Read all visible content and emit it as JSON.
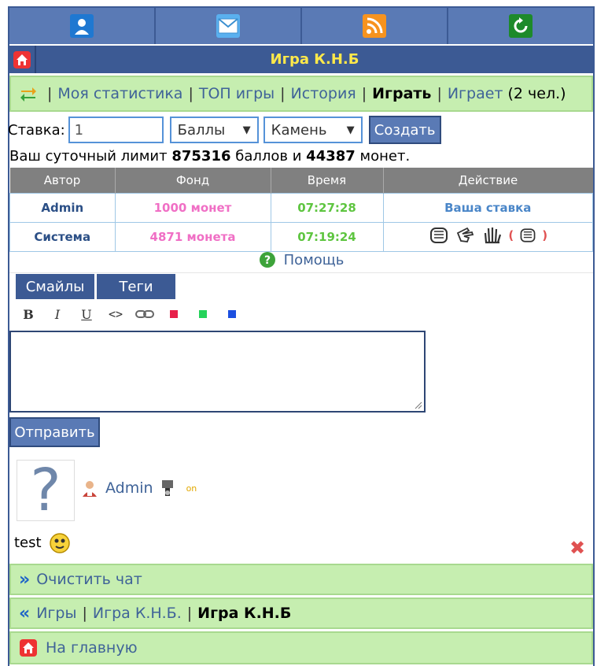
{
  "topbar": {
    "icons": [
      "user-icon",
      "mail-icon",
      "rss-icon",
      "refresh-icon"
    ]
  },
  "title": "Игра К.Н.Б",
  "nav": {
    "stats": "Моя статистика",
    "top": "ТОП игры",
    "history": "История",
    "play": "Играть",
    "playing": "Играет",
    "playing_count": "(2 чел.)"
  },
  "bet": {
    "label": "Ставка:",
    "value": "1",
    "currency": "Баллы",
    "choice": "Камень",
    "create": "Создать"
  },
  "limit": {
    "prefix": "Ваш суточный лимит",
    "points": "875316",
    "mid": "баллов и",
    "coins": "44387",
    "suffix": "монет."
  },
  "table": {
    "headers": [
      "Автор",
      "Фонд",
      "Время",
      "Действие"
    ],
    "rows": [
      {
        "author": "Admin",
        "fund": "1000 монет",
        "time": "07:27:28",
        "action": "Ваша ставка"
      },
      {
        "author": "Система",
        "fund": "4871 монета",
        "time": "07:19:24",
        "action": ""
      }
    ]
  },
  "help": "Помощь",
  "editor": {
    "tab_smiles": "Смайлы",
    "tab_tags": "Теги",
    "bold": "B",
    "italic": "I",
    "underline": "U",
    "code": "<>",
    "send": "Отправить"
  },
  "message": {
    "avatar": "?",
    "author": "Admin",
    "status": "on",
    "text": "test"
  },
  "footer": {
    "clear": "Очистить чат",
    "games": "Игры",
    "game_knb": "Игра К.Н.Б.",
    "current": "Игра К.Н.Б",
    "home": "На главную"
  },
  "colors": {
    "primary": "#3c5a94",
    "title_text": "#ffe94a",
    "green_bg": "#c6eeb0",
    "link": "#3f6398"
  }
}
